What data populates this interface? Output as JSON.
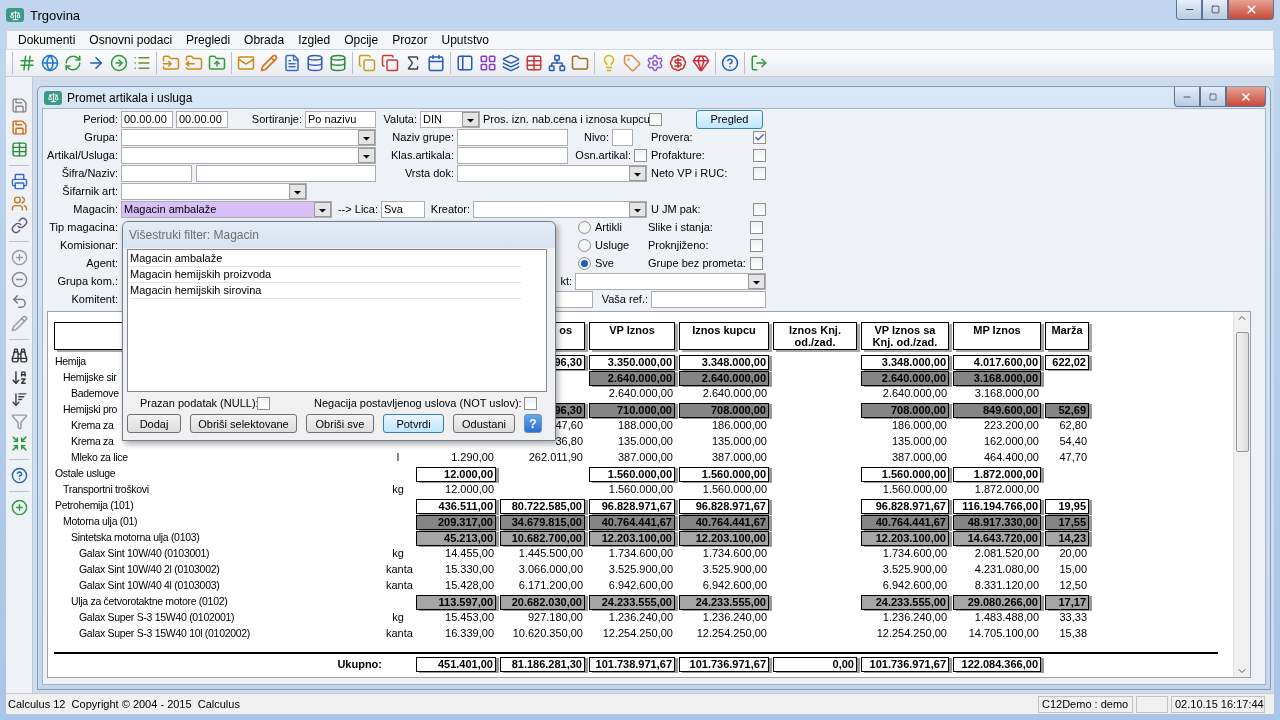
{
  "window": {
    "title": "Trgovina"
  },
  "menu": [
    "Dokumenti",
    "Osnovni podaci",
    "Pregledi",
    "Obrada",
    "Izgled",
    "Opcije",
    "Prozor",
    "Uputstvo"
  ],
  "child_window": {
    "title": "Promet artikala i usluga"
  },
  "form": {
    "period": {
      "label": "Period:",
      "from": "00.00.00",
      "to": "00.00.00"
    },
    "sortiranje": {
      "label": "Sortiranje:",
      "value": "Po nazivu"
    },
    "valuta": {
      "label": "Valuta:",
      "value": "DIN"
    },
    "pros_izn": {
      "label": "Pros. izn. nab.cena i iznosa kupcu",
      "checked": false
    },
    "pregled_button": "Pregled",
    "grupa": {
      "label": "Grupa:"
    },
    "naziv_grupe": {
      "label": "Naziv grupe:"
    },
    "nivo": {
      "label": "Nivo:"
    },
    "artikal_usluga": {
      "label": "Artikal/Usluga:"
    },
    "klas_artikala": {
      "label": "Klas.artikala:"
    },
    "osn_artikal": {
      "label": "Osn.artikal:",
      "checked": false
    },
    "sifra_naziv": {
      "label": "Šifra/Naziv:"
    },
    "vrsta_dok": {
      "label": "Vrsta dok:"
    },
    "sifarnik_art": {
      "label": "Šifarnik art:"
    },
    "magacin": {
      "label": "Magacin:",
      "value": "Magacin ambalaže",
      "highlighted": true
    },
    "lica": {
      "label": "--> Lica:",
      "value": "Sva"
    },
    "kreator": {
      "label": "Kreator:"
    },
    "covered_rows": [
      {
        "label": "Tip magacina:"
      },
      {
        "label": "Komisionar:"
      },
      {
        "label": "Agent:"
      },
      {
        "label": "Grupa kom.:"
      },
      {
        "label": "Komitent:"
      }
    ],
    "partial_label": "kt:",
    "vasa_ref": {
      "label": "Vaša ref.:"
    },
    "radio_options": [
      {
        "label": "Artikli",
        "selected": false
      },
      {
        "label": "Usluge",
        "selected": false
      },
      {
        "label": "Sve",
        "selected": true
      }
    ],
    "options": [
      {
        "label": "Provera:",
        "checked": true
      },
      {
        "label": "Profakture:",
        "checked": false
      },
      {
        "label": "Neto VP i RUC:",
        "checked": false
      },
      {
        "label": "U JM pak:",
        "checked": false
      },
      {
        "label": "Slike i stanja:",
        "checked": false
      },
      {
        "label": "Proknjiženo:",
        "checked": false
      },
      {
        "label": "Grupe bez prometa:",
        "checked": false
      }
    ]
  },
  "filter_dialog": {
    "title": "Višestruki filter: Magacin",
    "items": [
      "Magacin ambalaže",
      "Magacin hemijskih proizvoda",
      "Magacin hemijskih sirovina"
    ],
    "null_check": {
      "label": "Prazan podatak (NULL):",
      "checked": false
    },
    "not_check": {
      "label": "Negacija postavljenog uslova (NOT uslov):",
      "checked": false
    },
    "buttons": [
      {
        "label": "Dodaj",
        "default": false
      },
      {
        "label": "Obriši selektovane",
        "default": false
      },
      {
        "label": "Obriši sve",
        "default": false
      },
      {
        "label": "Potvrdi",
        "default": true
      },
      {
        "label": "Odustani",
        "default": false
      }
    ],
    "help_button": "?"
  },
  "table": {
    "columns": [
      "os",
      "VP Iznos",
      "Iznos kupcu",
      "Iznos Knj. od./zad.",
      "VP Iznos sa Knj. od./zad.",
      "MP Iznos",
      "Marža"
    ],
    "rows": [
      {
        "name": "Hemija",
        "column_4": "96,30",
        "vp_iznos": "3.350.000,00",
        "iznos_kupcu": "3.348.000,00",
        "vp_iznos_sa_knj": "3.348.000,00",
        "mp_iznos": "4.017.600,00",
        "marza": "622,02",
        "children": [
          {
            "name": "Hemijske sir",
            "vp_iznos": "2.640.000,00",
            "iznos_kupcu": "2.640.000,00",
            "vp_iznos_sa_knj": "2.640.000,00",
            "mp_iznos": "3.168.000,00",
            "children": [
              {
                "name": "Bademove",
                "vp_iznos": "2.640.000,00",
                "iznos_kupcu": "2.640.000,00",
                "vp_iznos_sa_knj": "2.640.000,00",
                "mp_iznos": "3.168.000,00"
              }
            ]
          },
          {
            "name": "Hemijski pro",
            "column_4": "96,30",
            "vp_iznos": "710.000,00",
            "iznos_kupcu": "708.000,00",
            "vp_iznos_sa_knj": "708.000,00",
            "mp_iznos": "849.600,00",
            "marza": "52,69",
            "children": [
              {
                "name": "Krema za",
                "column_4": "47,60",
                "vp_iznos": "188.000,00",
                "iznos_kupcu": "186.000,00",
                "vp_iznos_sa_knj": "186.000,00",
                "mp_iznos": "223.200,00",
                "marza": "62,80"
              },
              {
                "name": "Krema za",
                "column_4": "36,80",
                "vp_iznos": "135.000,00",
                "iznos_kupcu": "135.000,00",
                "vp_iznos_sa_knj": "135.000,00",
                "mp_iznos": "162.000,00",
                "marza": "54,40"
              },
              {
                "name": "Mleko za lice",
                "jm": "l",
                "column_3": "1.290,00",
                "column_4": "262.011,90",
                "vp_iznos": "387.000,00",
                "iznos_kupcu": "387.000,00",
                "vp_iznos_sa_knj": "387.000,00",
                "mp_iznos": "464.400,00",
                "marza": "47,70"
              }
            ]
          }
        ]
      },
      {
        "name": "Ostale usluge",
        "column_3": "12.000,00",
        "vp_iznos": "1.560.000,00",
        "iznos_kupcu": "1.560.000,00",
        "vp_iznos_sa_knj": "1.560.000,00",
        "mp_iznos": "1.872.000,00",
        "children": [
          {
            "name": "Transportni troškovi",
            "jm": "kg",
            "column_3": "12.000,00",
            "vp_iznos": "1.560.000,00",
            "iznos_kupcu": "1.560.000,00",
            "vp_iznos_sa_knj": "1.560.000,00",
            "mp_iznos": "1.872.000,00"
          }
        ]
      },
      {
        "name": "Petrohemija (101)",
        "column_3": "436.511,00",
        "column_4": "80.722.585,00",
        "vp_iznos": "96.828.971,67",
        "iznos_kupcu": "96.828.971,67",
        "vp_iznos_sa_knj": "96.828.971,67",
        "mp_iznos": "116.194.766,00",
        "marza": "19,95",
        "children": [
          {
            "name": "Motorna ulja (01)",
            "column_3": "209.317,00",
            "column_4": "34.679.815,00",
            "vp_iznos": "40.764.441,67",
            "iznos_kupcu": "40.764.441,67",
            "vp_iznos_sa_knj": "40.764.441,67",
            "mp_iznos": "48.917.330,00",
            "marza": "17,55",
            "children": [
              {
                "name": "Sintetska motorna ulja (0103)",
                "column_3": "45.213,00",
                "column_4": "10.682.700,00",
                "vp_iznos": "12.203.100,00",
                "iznos_kupcu": "12.203.100,00",
                "vp_iznos_sa_knj": "12.203.100,00",
                "mp_iznos": "14.643.720,00",
                "marza": "14,23",
                "children": [
                  {
                    "name": "Galax Sint 10W/40 (0103001)",
                    "jm": "kg",
                    "column_3": "14.455,00",
                    "column_4": "1.445.500,00",
                    "vp_iznos": "1.734.600,00",
                    "iznos_kupcu": "1.734.600,00",
                    "vp_iznos_sa_knj": "1.734.600,00",
                    "mp_iznos": "2.081.520,00",
                    "marza": "20,00"
                  },
                  {
                    "name": "Galax Sint 10W/40 2l (0103002)",
                    "jm": "kanta",
                    "column_3": "15.330,00",
                    "column_4": "3.066.000,00",
                    "vp_iznos": "3.525.900,00",
                    "iznos_kupcu": "3.525.900,00",
                    "vp_iznos_sa_knj": "3.525.900,00",
                    "mp_iznos": "4.231.080,00",
                    "marza": "15,00"
                  },
                  {
                    "name": "Galax Sint 10W/40 4l (0103003)",
                    "jm": "kanta",
                    "column_3": "15.428,00",
                    "column_4": "6.171.200,00",
                    "vp_iznos": "6.942.600,00",
                    "iznos_kupcu": "6.942.600,00",
                    "vp_iznos_sa_knj": "6.942.600,00",
                    "mp_iznos": "8.331.120,00",
                    "marza": "12,50"
                  }
                ]
              },
              {
                "name": "Ulja za četvorotaktne motore (0102)",
                "column_3": "113.597,00",
                "column_4": "20.682.030,00",
                "vp_iznos": "24.233.555,00",
                "iznos_kupcu": "24.233.555,00",
                "vp_iznos_sa_knj": "24.233.555,00",
                "mp_iznos": "29.080.266,00",
                "marza": "17,17",
                "children": [
                  {
                    "name": "Galax Super S-3 15W40 (0102001)",
                    "jm": "kg",
                    "column_3": "15.453,00",
                    "column_4": "927.180,00",
                    "vp_iznos": "1.236.240,00",
                    "iznos_kupcu": "1.236.240,00",
                    "vp_iznos_sa_knj": "1.236.240,00",
                    "mp_iznos": "1.483.488,00",
                    "marza": "33,33"
                  },
                  {
                    "name": "Galax Super S-3 15W40 10l (0102002)",
                    "jm": "kanta",
                    "column_3": "16.339,00",
                    "column_4": "10.620.350,00",
                    "vp_iznos": "12.254.250,00",
                    "iznos_kupcu": "12.254.250,00",
                    "vp_iznos_sa_knj": "12.254.250,00",
                    "mp_iznos": "14.705.100,00",
                    "marza": "15,38"
                  }
                ]
              }
            ]
          }
        ]
      }
    ],
    "totals": {
      "label": "Ukupno:",
      "column_3": "451.401,00",
      "column_4": "81.186.281,30",
      "vp_iznos": "101.738.971,67",
      "iznos_kupcu": "101.736.971,67",
      "iznos_knj_od_zad": "0,00",
      "vp_iznos_sa_knj": "101.736.971,67",
      "mp_iznos": "122.084.366,00"
    }
  },
  "status_bar": {
    "left": "Calculus 12  Copyright © 2004 - 2015  Calculus",
    "user": "C12Demo : demo",
    "datetime": "02.10.15 16:17:44"
  }
}
